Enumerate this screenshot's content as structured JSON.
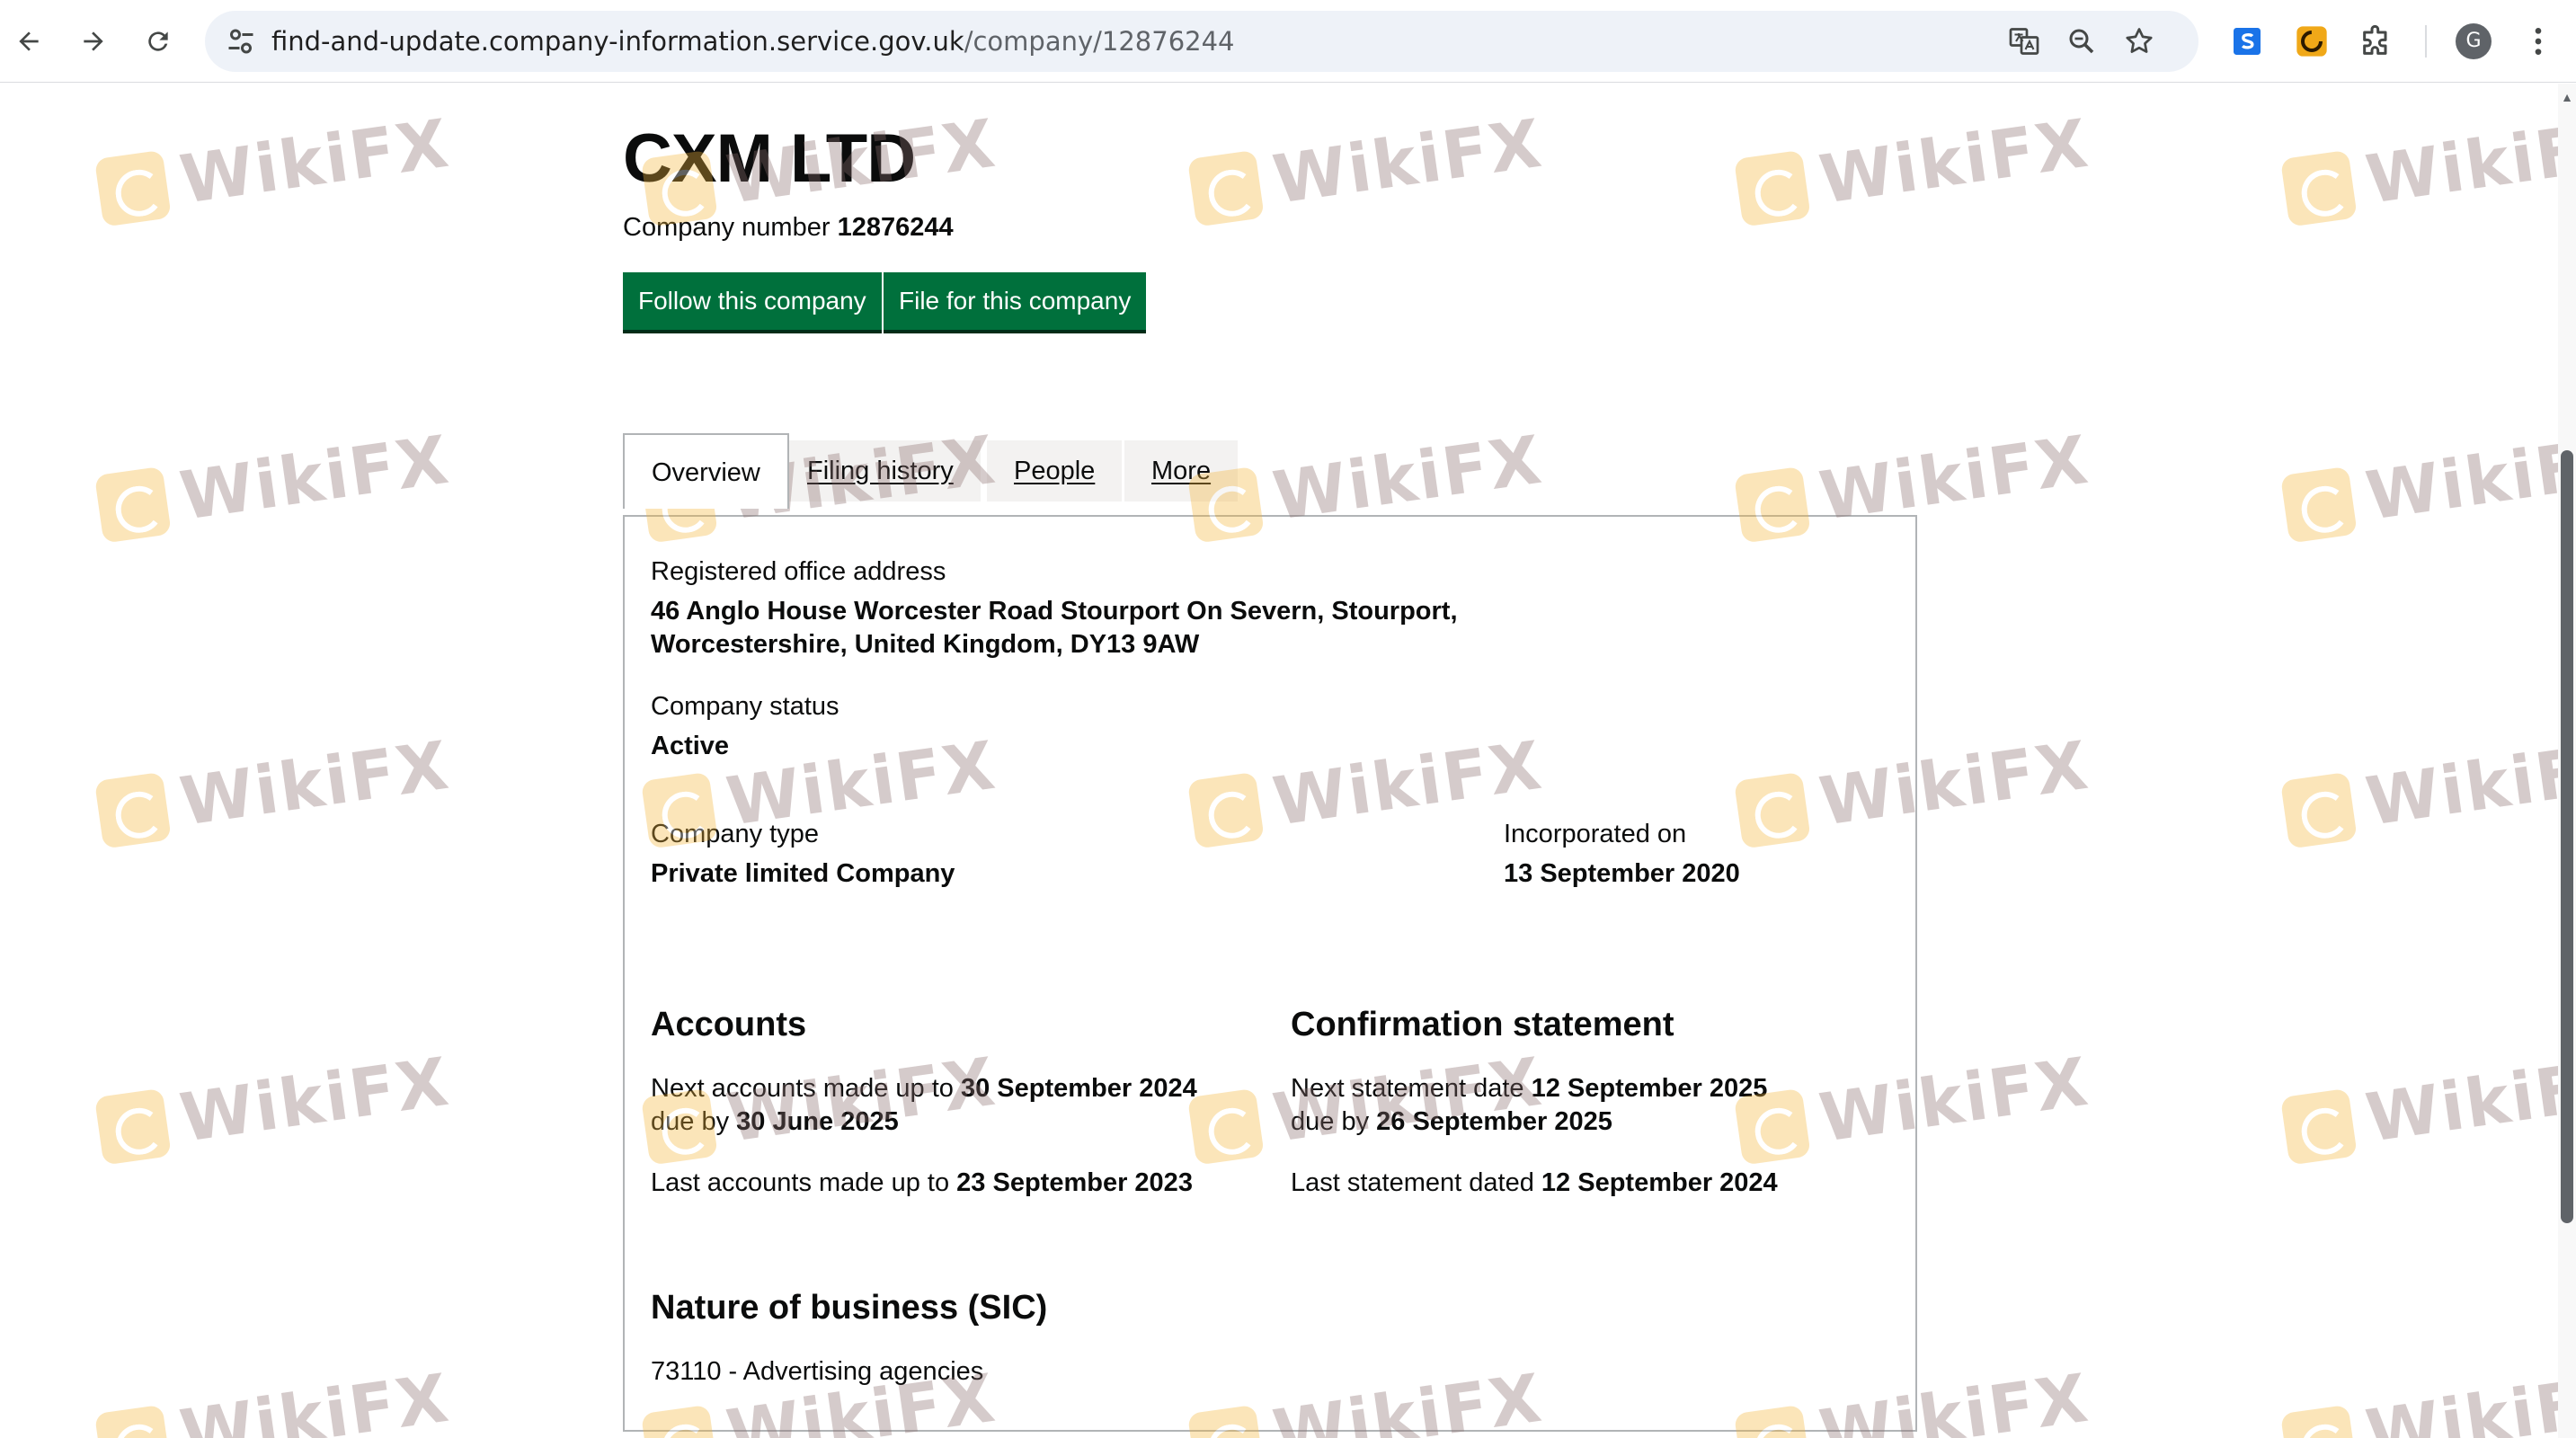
{
  "browser": {
    "url_host": "find-and-update.company-information.service.gov.uk",
    "url_path": "/company/12876244",
    "avatar_initial": "G"
  },
  "company": {
    "name": "CXM LTD",
    "number_label": "Company number",
    "number": "12876244"
  },
  "actions": {
    "follow_label": "Follow this company",
    "file_label": "File for this company"
  },
  "tabs": [
    {
      "label": "Overview",
      "active": true
    },
    {
      "label": "Filing history",
      "active": false
    },
    {
      "label": "People",
      "active": false
    },
    {
      "label": "More",
      "active": false
    }
  ],
  "overview": {
    "address_label": "Registered office address",
    "address_line1": "46 Anglo House Worcester Road Stourport On Severn, Stourport,",
    "address_line2": "Worcestershire, United Kingdom, DY13 9AW",
    "status_label": "Company status",
    "status": "Active",
    "type_label": "Company type",
    "type": "Private limited Company",
    "incorporated_label": "Incorporated on",
    "incorporated": "13 September 2020"
  },
  "accounts": {
    "heading": "Accounts",
    "next_prefix": "Next accounts made up to",
    "next_date": "30 September 2024",
    "due_prefix": "due by",
    "due_date": "30 June 2025",
    "last_prefix": "Last accounts made up to",
    "last_date": "23 September 2023"
  },
  "confirmation": {
    "heading": "Confirmation statement",
    "next_prefix": "Next statement date",
    "next_date": "12 September 2025",
    "due_prefix": "due by",
    "due_date": "26 September 2025",
    "last_prefix": "Last statement dated",
    "last_date": "12 September 2024"
  },
  "sic": {
    "heading": "Nature of business (SIC)",
    "item": "73110 - Advertising agencies"
  },
  "watermark": {
    "text": "WikiFX"
  },
  "colors": {
    "button_green": "#00703c",
    "link_blue": "#1d70b8",
    "tab_border": "#b1b4b6"
  }
}
